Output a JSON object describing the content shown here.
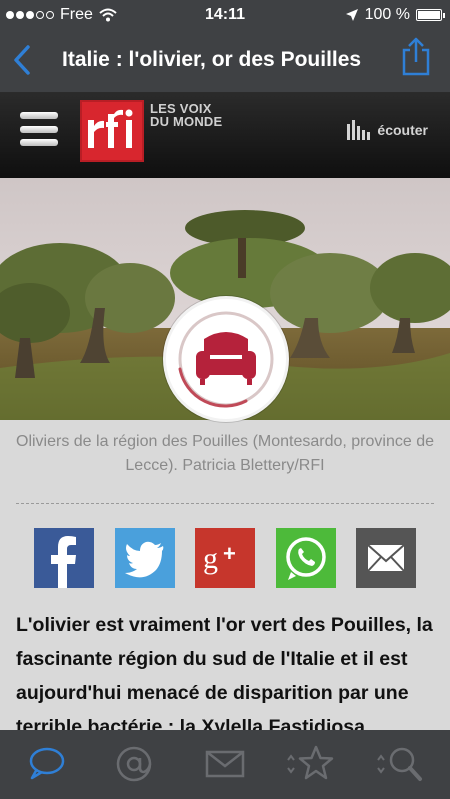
{
  "status": {
    "carrier": "Free",
    "time": "14:11",
    "battery": "100 %",
    "battery_level": 1.0
  },
  "nav": {
    "title": "Italie : l'olivier, or des Pouilles"
  },
  "header": {
    "logo_text": "rfi",
    "tagline_line1": "LES VOIX",
    "tagline_line2": "DU MONDE",
    "listen_label": "écouter"
  },
  "photo": {
    "caption": "Oliviers de la région des Pouilles (Montesardo, province de Lecce). Patricia Blettery/RFI"
  },
  "article": {
    "lead": "L'olivier est vraiment l'or vert des Pouilles, la fascinante région du sud de l'Italie et il est aujourd'hui menacé de disparition par une terrible bactérie : la Xylella Fastidiosa."
  },
  "share": [
    "facebook-icon",
    "twitter-icon",
    "google-plus-icon",
    "whatsapp-icon",
    "mail-icon"
  ],
  "tabs": [
    "chat-bubble-icon",
    "at-sign-icon",
    "envelope-icon",
    "star-icon",
    "search-icon"
  ],
  "colors": {
    "bar": "#3f4144",
    "accent": "#2f7fd6",
    "rfi_red": "#d8262e",
    "badge_red": "#b5223b"
  }
}
